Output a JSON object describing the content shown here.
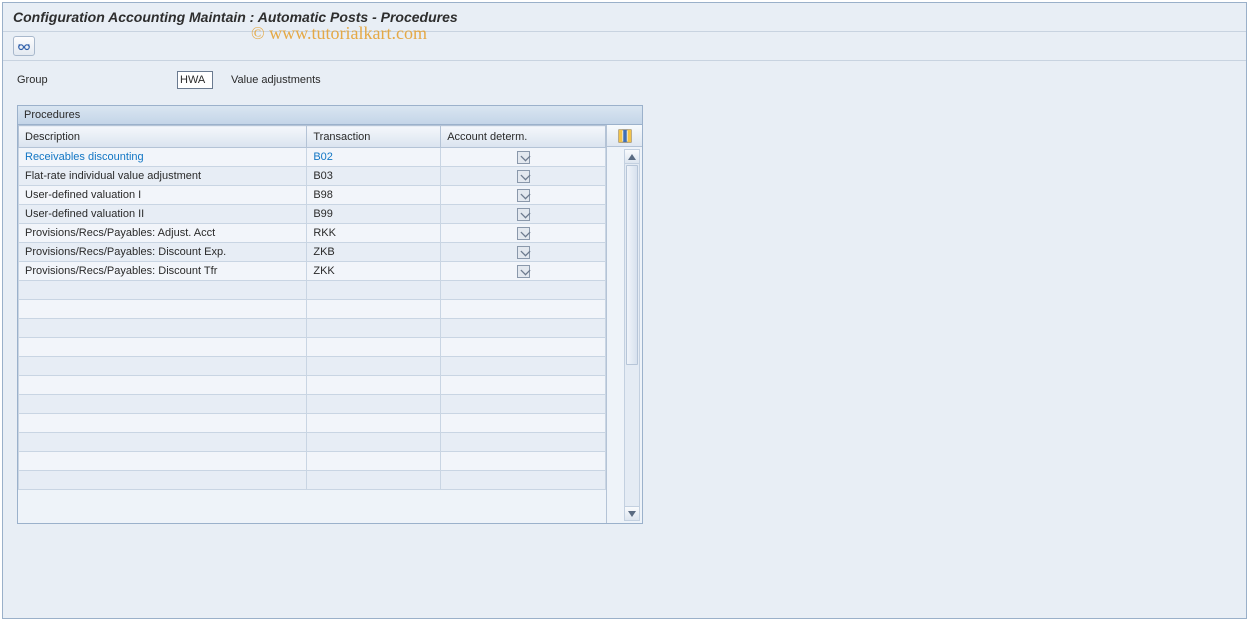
{
  "title": "Configuration Accounting Maintain : Automatic Posts - Procedures",
  "watermark": "© www.tutorialkart.com",
  "form": {
    "group_label": "Group",
    "group_value": "HWA",
    "group_desc": "Value adjustments"
  },
  "panel": {
    "title": "Procedures",
    "columns": {
      "description": "Description",
      "transaction": "Transaction",
      "account_determ": "Account determ."
    },
    "rows": [
      {
        "description": "Receivables discounting",
        "transaction": "B02",
        "account_determ": true,
        "selected": true
      },
      {
        "description": "Flat-rate individual value adjustment",
        "transaction": "B03",
        "account_determ": true
      },
      {
        "description": "User-defined valuation I",
        "transaction": "B98",
        "account_determ": true
      },
      {
        "description": "User-defined valuation II",
        "transaction": "B99",
        "account_determ": true
      },
      {
        "description": "Provisions/Recs/Payables: Adjust. Acct",
        "transaction": "RKK",
        "account_determ": true
      },
      {
        "description": "Provisions/Recs/Payables: Discount Exp.",
        "transaction": "ZKB",
        "account_determ": true
      },
      {
        "description": "Provisions/Recs/Payables: Discount Tfr",
        "transaction": "ZKK",
        "account_determ": true
      }
    ],
    "empty_rows": 11
  }
}
